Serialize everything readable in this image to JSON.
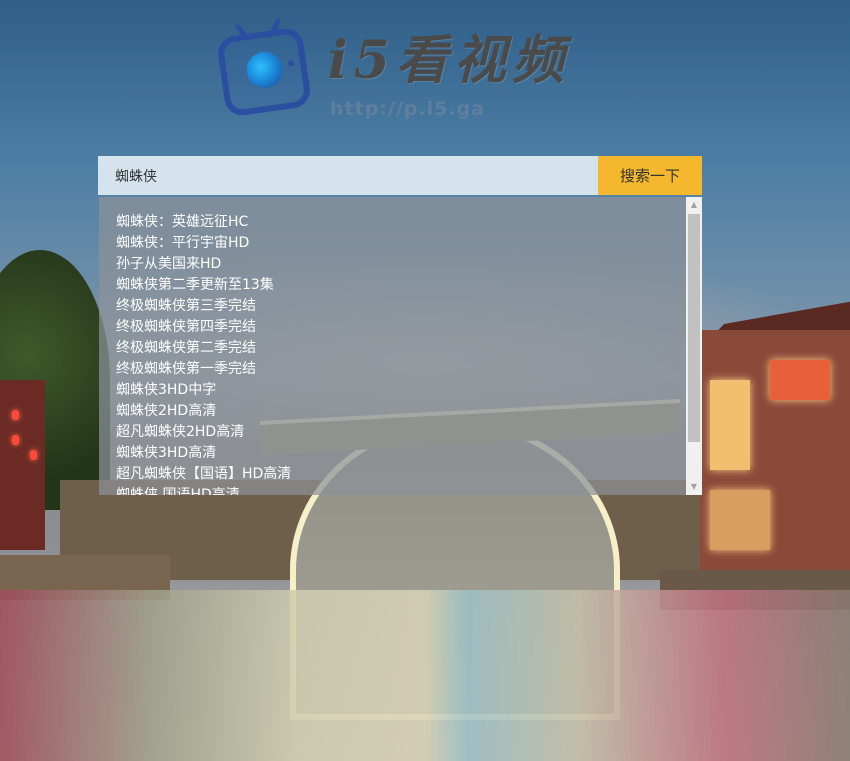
{
  "brand": {
    "name": "i5看视频",
    "url": "http://p.i5.ga"
  },
  "search": {
    "query": "蜘蛛侠",
    "button_label": "搜索一下"
  },
  "suggestions": [
    "蜘蛛侠：英雄远征HC",
    "蜘蛛侠：平行宇宙HD",
    "孙子从美国来HD",
    "蜘蛛侠第二季更新至13集",
    "终极蜘蛛侠第三季完结",
    "终极蜘蛛侠第四季完结",
    "终极蜘蛛侠第二季完结",
    "终极蜘蛛侠第一季完结",
    "蜘蛛侠3HD中字",
    "蜘蛛侠2HD高清",
    "超凡蜘蛛侠2HD高清",
    "蜘蛛侠3HD高清",
    "超凡蜘蛛侠【国语】HD高清",
    "蜘蛛侠 国语HD高清"
  ],
  "colors": {
    "button": "#f4b72e",
    "logo_blue": "#2a4fa0"
  },
  "icons": {
    "logo": "tv-logo-icon",
    "scroll_up": "scroll-up-arrow-icon",
    "scroll_down": "scroll-down-arrow-icon"
  }
}
